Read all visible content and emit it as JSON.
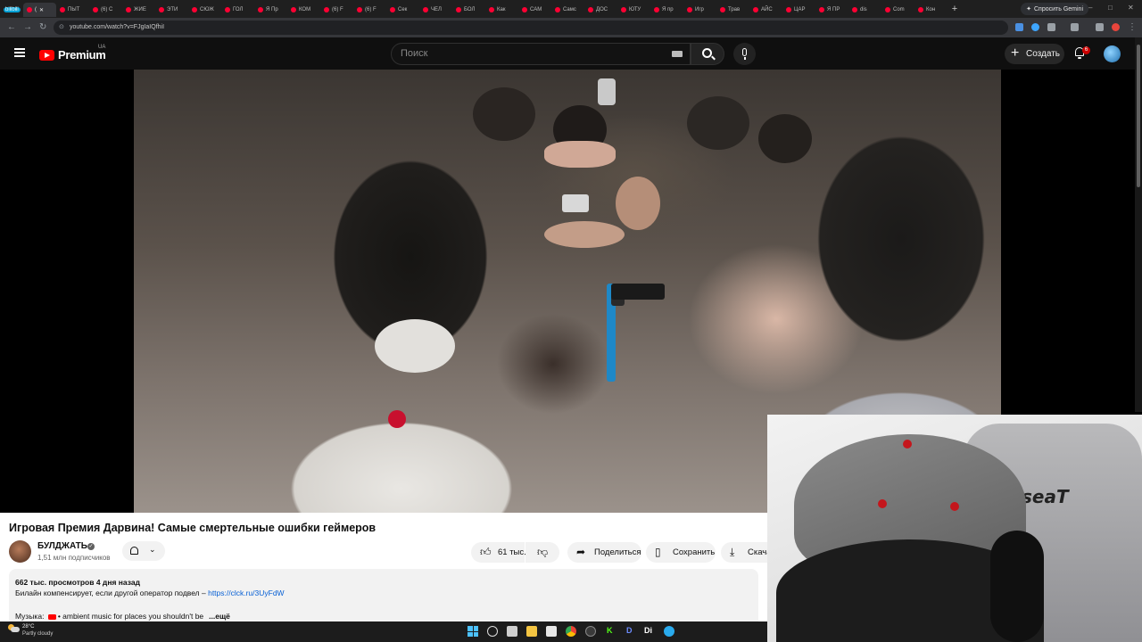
{
  "browser": {
    "tabs": [
      {
        "label": "bilibili",
        "badge": true
      },
      {
        "label": "(",
        "active": true
      },
      {
        "label": "ПЫТ"
      },
      {
        "label": "(6) C"
      },
      {
        "label": "ЖИЕ"
      },
      {
        "label": "ЭТИ"
      },
      {
        "label": "СЮЖ"
      },
      {
        "label": "ГОЛ"
      },
      {
        "label": "Я Пр"
      },
      {
        "label": "КОМ"
      },
      {
        "label": "(6) F"
      },
      {
        "label": "(6) F"
      },
      {
        "label": "Сек"
      },
      {
        "label": "ЧЕЛ"
      },
      {
        "label": "БОЛ"
      },
      {
        "label": "Как"
      },
      {
        "label": "САМ"
      },
      {
        "label": "Самс"
      },
      {
        "label": "ДОС"
      },
      {
        "label": "ЮТУ"
      },
      {
        "label": "Я пр"
      },
      {
        "label": "Игр"
      },
      {
        "label": "Трав"
      },
      {
        "label": "АЙС"
      },
      {
        "label": "ЦАР"
      },
      {
        "label": "Я ПР"
      },
      {
        "label": "dis"
      },
      {
        "label": "Com"
      },
      {
        "label": "Кон"
      }
    ],
    "new_tab": "+",
    "gemini_label": "Спросить Gemini",
    "url": "youtube.com/watch?v=FJgIaIQfhiI",
    "window_controls": [
      "–",
      "□",
      "✕"
    ]
  },
  "youtube": {
    "logo_text": "Premium",
    "region": "UA",
    "search_placeholder": "Поиск",
    "create_label": "Создать",
    "notification_count": "6"
  },
  "video": {
    "title": "Игровая Премия Дарвина! Самые смертельные ошибки геймеров",
    "channel_name": "БУЛДЖАТЬ",
    "subscribers": "1,51 млн подписчиков",
    "like_count": "61 тыс.",
    "share_label": "Поделиться",
    "save_label": "Сохранить",
    "download_label": "Скачать",
    "views_date": "662 тыс. просмотров  4 дня назад",
    "desc_line1_text": "Билайн компенсирует, если другой оператор подвел – ",
    "desc_link": "https://clck.ru/3UyFdW",
    "desc_music_label": "Музыка:",
    "desc_music_text": "• ambient music for places you shouldn't be",
    "desc_more": "...ещё"
  },
  "webcam": {
    "chair_brand": "seaT"
  },
  "taskbar": {
    "temperature": "28°C",
    "weather": "Partly cloudy",
    "app_letters": [
      "K",
      "D",
      "Di"
    ]
  },
  "colors": {
    "yt_red": "#ff0000",
    "link_blue": "#065fd4",
    "bg_dark": "#0f0f0f"
  }
}
